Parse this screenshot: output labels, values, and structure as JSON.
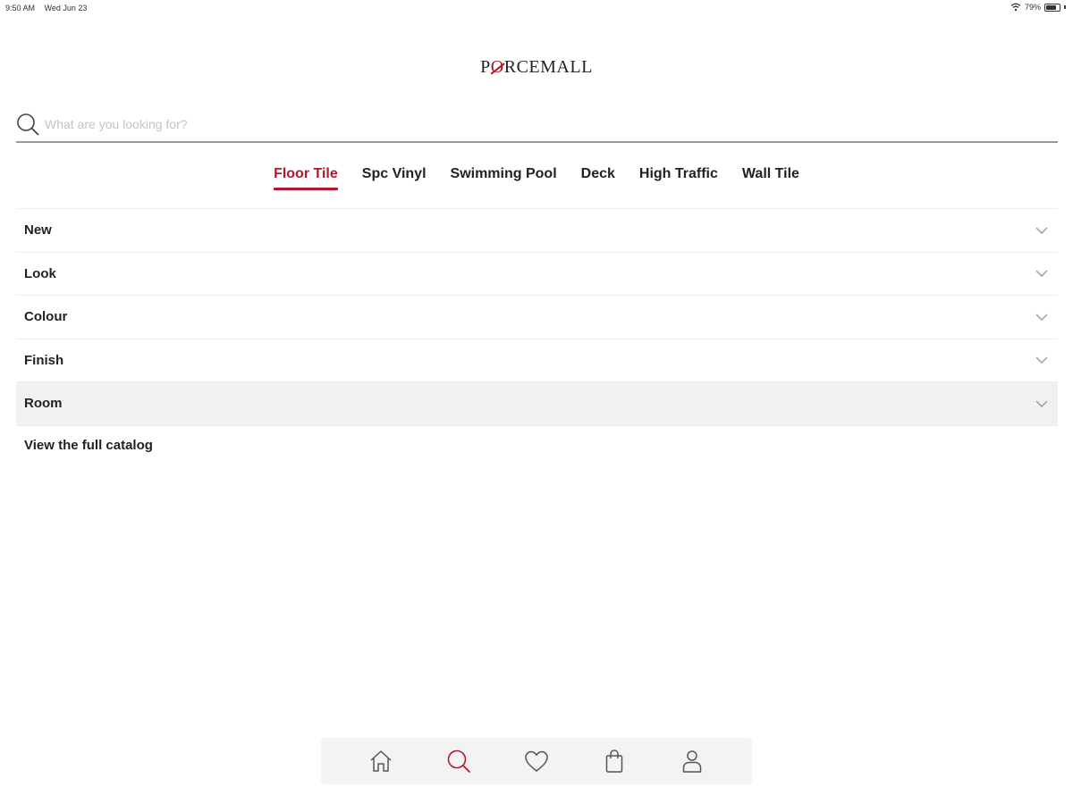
{
  "status_bar": {
    "time": "9:50 AM",
    "date": "Wed Jun 23",
    "battery": "79%",
    "battery_level": 0.79
  },
  "brand": {
    "logo_prefix": "P",
    "logo_o": "O",
    "logo_suffix": "RCEMALL"
  },
  "search": {
    "placeholder": "What are you looking for?",
    "value": ""
  },
  "tabs": [
    {
      "label": "Floor Tile",
      "active": true
    },
    {
      "label": "Spc Vinyl",
      "active": false
    },
    {
      "label": "Swimming Pool",
      "active": false
    },
    {
      "label": "Deck",
      "active": false
    },
    {
      "label": "High Traffic",
      "active": false
    },
    {
      "label": "Wall Tile",
      "active": false
    }
  ],
  "filters": [
    {
      "label": "New"
    },
    {
      "label": "Look"
    },
    {
      "label": "Colour"
    },
    {
      "label": "Finish"
    },
    {
      "label": "Room",
      "highlighted": true
    }
  ],
  "catalog_link": "View the full catalog",
  "bottom_nav": [
    {
      "icon": "home-icon",
      "active": false
    },
    {
      "icon": "search-icon",
      "active": true
    },
    {
      "icon": "heart-icon",
      "active": false
    },
    {
      "icon": "shopping-bag-icon",
      "active": false
    },
    {
      "icon": "user-icon",
      "active": false
    }
  ],
  "colors": {
    "accent": "#b2182b",
    "text": "#222222",
    "nav_bg": "#f3f3f4",
    "highlight_row": "#f0f1f2"
  }
}
